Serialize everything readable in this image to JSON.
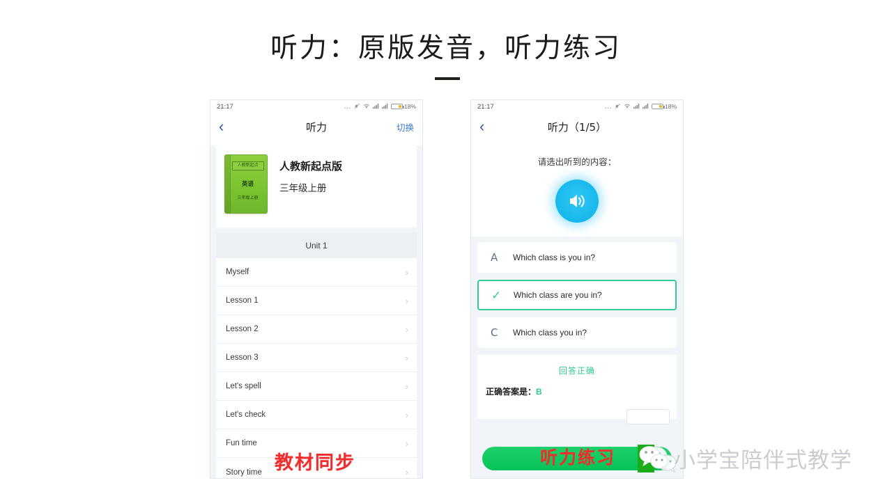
{
  "slide": {
    "title": "听力：原版发音，听力练习",
    "rule": ""
  },
  "phone_left": {
    "statusbar": {
      "time": "21:17",
      "dots": "…",
      "mute_icon": "mute-icon",
      "wifi_icon": "wifi-icon",
      "signal_icon_1": "signal-icon",
      "signal_icon_2": "signal-icon",
      "battery_pct": "18%"
    },
    "navbar": {
      "back": "‹",
      "title": "听力",
      "action": "切换"
    },
    "book": {
      "cover_publisher": "人教新起点",
      "cover_subject": "英语",
      "cover_grade": "三年级上册",
      "title": "人教新起点版",
      "grade": "三年级上册"
    },
    "unit_header": "Unit 1",
    "lessons": [
      {
        "label": "Myself"
      },
      {
        "label": "Lesson 1"
      },
      {
        "label": "Lesson 2"
      },
      {
        "label": "Lesson 3"
      },
      {
        "label": "Let's spell"
      },
      {
        "label": "Let's check"
      },
      {
        "label": "Fun time"
      },
      {
        "label": "Story time"
      }
    ],
    "chevron": "›",
    "stamp": "教材同步"
  },
  "phone_right": {
    "statusbar": {
      "time": "21:17",
      "dots": "…",
      "mute_icon": "mute-icon",
      "wifi_icon": "wifi-icon",
      "signal_icon_1": "signal-icon",
      "signal_icon_2": "signal-icon",
      "battery_pct": "18%"
    },
    "navbar": {
      "back": "‹",
      "title": "听力（1/5）"
    },
    "quiz": {
      "prompt": "请选出听到的内容：",
      "speaker_icon": "speaker-icon",
      "options": [
        {
          "letter": "A",
          "text": "Which class is you in?",
          "selected": false
        },
        {
          "letter": "✓",
          "text": "Which class are you in?",
          "selected": true
        },
        {
          "letter": "C",
          "text": "Which class you in?",
          "selected": false
        }
      ],
      "result_status": "回答正确",
      "result_label": "正确答案是：",
      "result_answer": "B"
    },
    "practice_button": "",
    "stamp": "听力练习"
  },
  "watermark": {
    "text": "小学宝陪伴式教学",
    "logo": "wechat-logo"
  },
  "colors": {
    "accent_green": "#2ecc94",
    "button_green": "#06c257",
    "speaker_blue": "#17b8ec",
    "nav_blue": "#3d7bd6",
    "stamp_red": "#ef2d2d",
    "book_green": "#79c330",
    "page_bg": "#f1f5f9"
  }
}
